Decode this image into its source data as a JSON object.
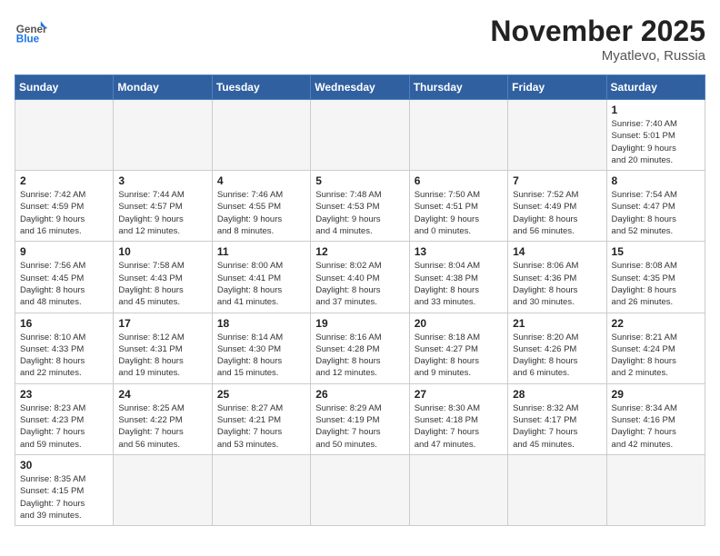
{
  "header": {
    "logo_general": "General",
    "logo_blue": "Blue",
    "month_year": "November 2025",
    "location": "Myatlevo, Russia"
  },
  "weekdays": [
    "Sunday",
    "Monday",
    "Tuesday",
    "Wednesday",
    "Thursday",
    "Friday",
    "Saturday"
  ],
  "days": [
    {
      "num": "",
      "info": ""
    },
    {
      "num": "",
      "info": ""
    },
    {
      "num": "",
      "info": ""
    },
    {
      "num": "",
      "info": ""
    },
    {
      "num": "",
      "info": ""
    },
    {
      "num": "",
      "info": ""
    },
    {
      "num": "1",
      "info": "Sunrise: 7:40 AM\nSunset: 5:01 PM\nDaylight: 9 hours\nand 20 minutes."
    },
    {
      "num": "2",
      "info": "Sunrise: 7:42 AM\nSunset: 4:59 PM\nDaylight: 9 hours\nand 16 minutes."
    },
    {
      "num": "3",
      "info": "Sunrise: 7:44 AM\nSunset: 4:57 PM\nDaylight: 9 hours\nand 12 minutes."
    },
    {
      "num": "4",
      "info": "Sunrise: 7:46 AM\nSunset: 4:55 PM\nDaylight: 9 hours\nand 8 minutes."
    },
    {
      "num": "5",
      "info": "Sunrise: 7:48 AM\nSunset: 4:53 PM\nDaylight: 9 hours\nand 4 minutes."
    },
    {
      "num": "6",
      "info": "Sunrise: 7:50 AM\nSunset: 4:51 PM\nDaylight: 9 hours\nand 0 minutes."
    },
    {
      "num": "7",
      "info": "Sunrise: 7:52 AM\nSunset: 4:49 PM\nDaylight: 8 hours\nand 56 minutes."
    },
    {
      "num": "8",
      "info": "Sunrise: 7:54 AM\nSunset: 4:47 PM\nDaylight: 8 hours\nand 52 minutes."
    },
    {
      "num": "9",
      "info": "Sunrise: 7:56 AM\nSunset: 4:45 PM\nDaylight: 8 hours\nand 48 minutes."
    },
    {
      "num": "10",
      "info": "Sunrise: 7:58 AM\nSunset: 4:43 PM\nDaylight: 8 hours\nand 45 minutes."
    },
    {
      "num": "11",
      "info": "Sunrise: 8:00 AM\nSunset: 4:41 PM\nDaylight: 8 hours\nand 41 minutes."
    },
    {
      "num": "12",
      "info": "Sunrise: 8:02 AM\nSunset: 4:40 PM\nDaylight: 8 hours\nand 37 minutes."
    },
    {
      "num": "13",
      "info": "Sunrise: 8:04 AM\nSunset: 4:38 PM\nDaylight: 8 hours\nand 33 minutes."
    },
    {
      "num": "14",
      "info": "Sunrise: 8:06 AM\nSunset: 4:36 PM\nDaylight: 8 hours\nand 30 minutes."
    },
    {
      "num": "15",
      "info": "Sunrise: 8:08 AM\nSunset: 4:35 PM\nDaylight: 8 hours\nand 26 minutes."
    },
    {
      "num": "16",
      "info": "Sunrise: 8:10 AM\nSunset: 4:33 PM\nDaylight: 8 hours\nand 22 minutes."
    },
    {
      "num": "17",
      "info": "Sunrise: 8:12 AM\nSunset: 4:31 PM\nDaylight: 8 hours\nand 19 minutes."
    },
    {
      "num": "18",
      "info": "Sunrise: 8:14 AM\nSunset: 4:30 PM\nDaylight: 8 hours\nand 15 minutes."
    },
    {
      "num": "19",
      "info": "Sunrise: 8:16 AM\nSunset: 4:28 PM\nDaylight: 8 hours\nand 12 minutes."
    },
    {
      "num": "20",
      "info": "Sunrise: 8:18 AM\nSunset: 4:27 PM\nDaylight: 8 hours\nand 9 minutes."
    },
    {
      "num": "21",
      "info": "Sunrise: 8:20 AM\nSunset: 4:26 PM\nDaylight: 8 hours\nand 6 minutes."
    },
    {
      "num": "22",
      "info": "Sunrise: 8:21 AM\nSunset: 4:24 PM\nDaylight: 8 hours\nand 2 minutes."
    },
    {
      "num": "23",
      "info": "Sunrise: 8:23 AM\nSunset: 4:23 PM\nDaylight: 7 hours\nand 59 minutes."
    },
    {
      "num": "24",
      "info": "Sunrise: 8:25 AM\nSunset: 4:22 PM\nDaylight: 7 hours\nand 56 minutes."
    },
    {
      "num": "25",
      "info": "Sunrise: 8:27 AM\nSunset: 4:21 PM\nDaylight: 7 hours\nand 53 minutes."
    },
    {
      "num": "26",
      "info": "Sunrise: 8:29 AM\nSunset: 4:19 PM\nDaylight: 7 hours\nand 50 minutes."
    },
    {
      "num": "27",
      "info": "Sunrise: 8:30 AM\nSunset: 4:18 PM\nDaylight: 7 hours\nand 47 minutes."
    },
    {
      "num": "28",
      "info": "Sunrise: 8:32 AM\nSunset: 4:17 PM\nDaylight: 7 hours\nand 45 minutes."
    },
    {
      "num": "29",
      "info": "Sunrise: 8:34 AM\nSunset: 4:16 PM\nDaylight: 7 hours\nand 42 minutes."
    },
    {
      "num": "30",
      "info": "Sunrise: 8:35 AM\nSunset: 4:15 PM\nDaylight: 7 hours\nand 39 minutes."
    },
    {
      "num": "",
      "info": ""
    },
    {
      "num": "",
      "info": ""
    },
    {
      "num": "",
      "info": ""
    },
    {
      "num": "",
      "info": ""
    },
    {
      "num": "",
      "info": ""
    },
    {
      "num": "",
      "info": ""
    }
  ]
}
